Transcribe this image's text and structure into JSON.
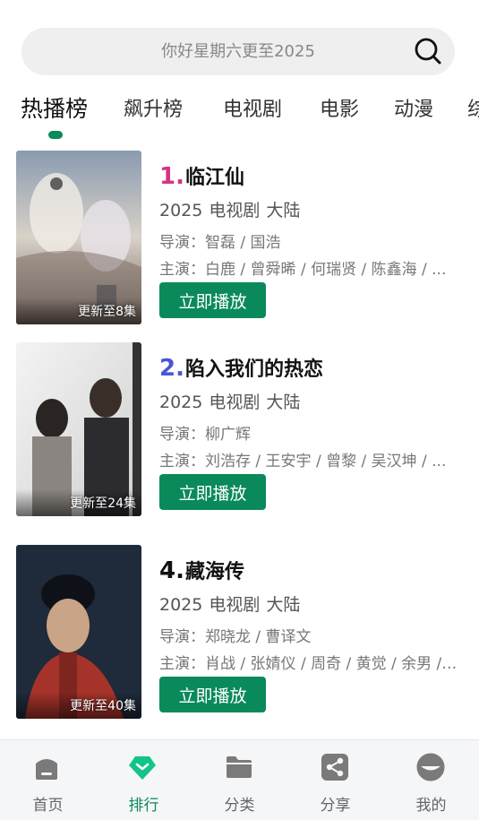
{
  "search": {
    "placeholder": "你好星期六更至2025"
  },
  "tabs": [
    {
      "label": "热播榜",
      "active": true
    },
    {
      "label": "飙升榜"
    },
    {
      "label": "电视剧"
    },
    {
      "label": "电影"
    },
    {
      "label": "动漫"
    },
    {
      "label": "综"
    }
  ],
  "items": [
    {
      "rank": "1.",
      "rank_color": "#d63384",
      "title": "临江仙",
      "year": "2025",
      "type": "电视剧",
      "region": "大陆",
      "director": "导演：智磊 / 国浩",
      "cast": "主演：白鹿 / 曾舜晞 / 何瑞贤 / 陈鑫海 / ...",
      "badge": "更新至8集",
      "play_label": "立即播放"
    },
    {
      "rank": "2.",
      "rank_color": "#4a55d6",
      "title": "陷入我们的热恋",
      "year": "2025",
      "type": "电视剧",
      "region": "大陆",
      "director": "导演：柳广辉",
      "cast": "主演：刘浩存 / 王安宇 / 曾黎 / 吴汉坤 / ...",
      "badge": "更新至24集",
      "play_label": "立即播放"
    },
    {
      "rank": "4.",
      "rank_color": "#111111",
      "title": "藏海传",
      "year": "2025",
      "type": "电视剧",
      "region": "大陆",
      "director": "导演：郑晓龙 / 曹译文",
      "cast": "主演：肖战 / 张婧仪 / 周奇 / 黄觉 / 余男 / ...",
      "badge": "更新至40集",
      "play_label": "立即播放"
    }
  ],
  "nav": [
    {
      "label": "首页",
      "icon": "home-icon"
    },
    {
      "label": "排行",
      "icon": "ranking-icon",
      "active": true
    },
    {
      "label": "分类",
      "icon": "folder-icon"
    },
    {
      "label": "分享",
      "icon": "share-icon"
    },
    {
      "label": "我的",
      "icon": "profile-icon"
    }
  ],
  "colors": {
    "accent": "#0a8a5a"
  }
}
